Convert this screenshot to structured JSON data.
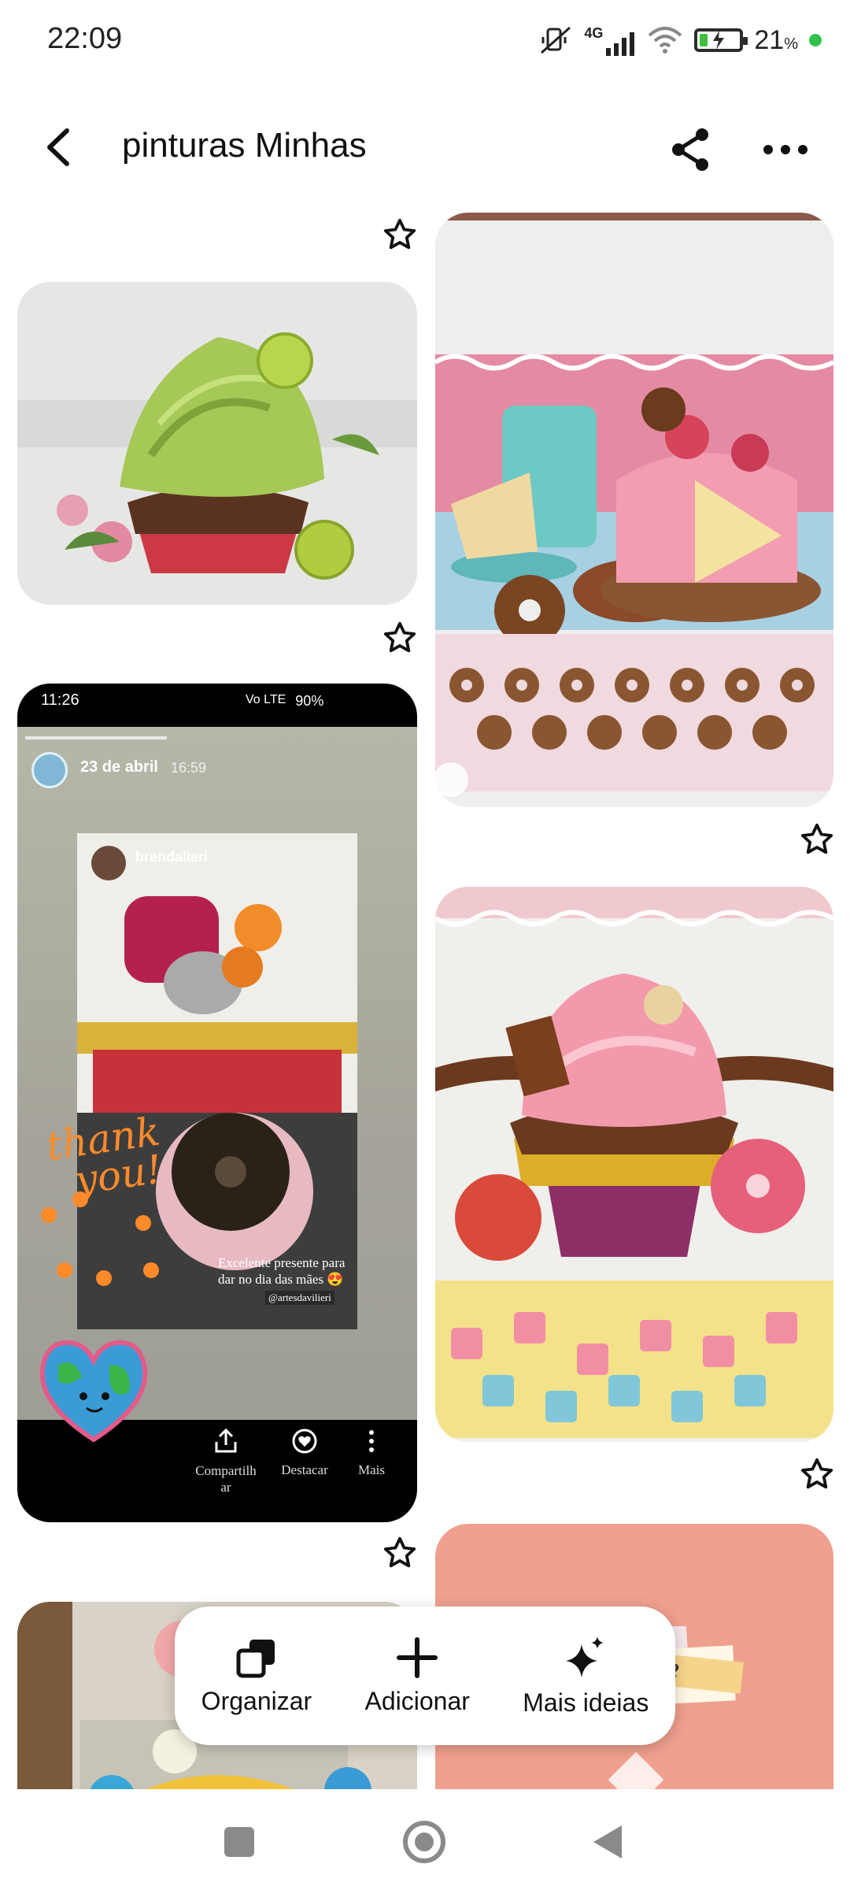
{
  "status_bar": {
    "time": "22:09",
    "network": "4G",
    "battery_percent": "21",
    "battery_symbol": "%",
    "battery_level": 0.21,
    "icons": [
      "mute-icon",
      "signal-icon",
      "wifi-icon",
      "battery-charging-icon",
      "green-dot"
    ]
  },
  "header": {
    "title": "pinturas Minhas",
    "back_icon": "chevron-left-icon",
    "share_icon": "share-icon",
    "more_icon": "more-horizontal-icon"
  },
  "pins": [
    {
      "id": "cupcake-green",
      "column": "left"
    },
    {
      "id": "cake-pink-towel",
      "column": "right"
    },
    {
      "id": "story-screenshot",
      "column": "left",
      "story": {
        "time": "11:26",
        "status_net": "Vo LTE",
        "battery": "90%",
        "date": "23 de abril",
        "date_time": "16:59",
        "username": "brendalieri",
        "caption_line1": "Excelente presente para",
        "caption_line2": "dar no dia das mães 😍",
        "caption_handle": "@artesdavilieri",
        "sticker_text1": "thank",
        "sticker_text2": "you!",
        "actions": [
          {
            "label": "Compartilh\nar",
            "icon": "upload-icon"
          },
          {
            "label": "Destacar",
            "icon": "heart-circle-icon"
          },
          {
            "label": "Mais",
            "icon": "vertical-dots-icon"
          }
        ]
      }
    },
    {
      "id": "cupcake-pink-towel",
      "column": "right"
    },
    {
      "id": "flower-painting",
      "column": "left"
    },
    {
      "id": "salmon-card",
      "column": "right",
      "partial_text": "ade"
    }
  ],
  "toolbar": {
    "organize_label": "Organizar",
    "add_label": "Adicionar",
    "ideas_label": "Mais ideias"
  },
  "colors": {
    "accent_green": "#3bbf3b",
    "salmon": "#f0a08e",
    "story_bg": "#1a1a1a"
  }
}
